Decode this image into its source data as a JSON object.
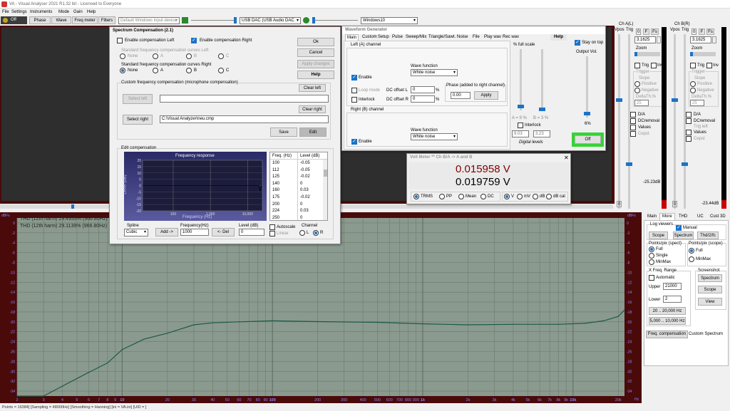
{
  "title": "VA - Visual Analyser 2021 R1.32 bit - Licensed to Everyone",
  "menu": [
    "File",
    "Settings",
    "Instruments",
    "Mode",
    "Gain",
    "Help"
  ],
  "toolbar": {
    "off": "Off",
    "phase": "Phase",
    "wave": "Wave",
    "freqmeter": "Freq meter",
    "filters": "Filters",
    "input_device": "Default Windows input device",
    "output_device": "USB DAC (USB Audio DAC",
    "os": "Windows10"
  },
  "spec_comp": {
    "title": "Spectrum Compensation (2.1)",
    "enable_left": "Enable compensation Left",
    "enable_right": "Enable compensation Right",
    "std_left": "Standard frequency compensation curves Left",
    "std_right": "Standard frequency compensation curves Right",
    "opts": [
      "None",
      "A",
      "B",
      "C"
    ],
    "ok": "Ok",
    "cancel": "Cancel",
    "apply": "Apply changes",
    "help": "Help",
    "custom_label": "Custom frequency compensation (microphone compensation)",
    "clear_left": "Clear left",
    "clear_right": "Clear right",
    "select_left": "Select left",
    "select_right": "Select right",
    "right_path": "C:\\Visual Analyzer\\neu.cmp",
    "save": "Save",
    "edit": "Edit",
    "edit_comp": "Edit compensation",
    "plot_title": "Frequency response",
    "plot_xlabel": "Frequency (Hz)",
    "plot_ylabel": "Level (dB)",
    "plot_yticks": [
      "20",
      "15",
      "10",
      "5",
      "0",
      "-5",
      "-10",
      "-15",
      "-20"
    ],
    "plot_xticks": [
      "100",
      "1,000",
      "10,000"
    ],
    "table_freq": "Freq. (Hz)",
    "table_level": "Level (dB)",
    "rows": [
      [
        "100",
        "-0.05"
      ],
      [
        "112",
        "-0.05"
      ],
      [
        "125",
        "-0.02"
      ],
      [
        "140",
        "0"
      ],
      [
        "160",
        "0.03"
      ],
      [
        "175",
        "-0.02"
      ],
      [
        "200",
        "0"
      ],
      [
        "224",
        "0.03"
      ],
      [
        "250",
        "0"
      ]
    ],
    "spline": "Spline",
    "spline_val": "Cubic",
    "add": "Add ->",
    "freq_lbl": "Frequency(Hz)",
    "freq_val": "1000",
    "del": "<- Del",
    "level_lbl": "Level (dB)",
    "level_val": "0",
    "autoscale": "Autoscale",
    "linear": "Linear",
    "channel": "Channel",
    "ch_l": "L",
    "ch_r": "R"
  },
  "wavegen": {
    "title": "Waveform Generator",
    "tabs": [
      "Main",
      "Custom",
      "Setup",
      "Pulse",
      "Sweep/Mix",
      "Triangle/Sawt.",
      "Noise",
      "File",
      "Play wav",
      "Rec wav",
      "Help"
    ],
    "left_ch": "Left (A) channel",
    "right_ch": "Right (B) channel",
    "wave_fn": "Wave function",
    "white_noise": "White noise",
    "enable": "Enable",
    "loop": "Loop mode",
    "interlock": "Interlock",
    "dcl": "DC offset L",
    "dcr": "DC offset R",
    "pct": "%",
    "zero": "0",
    "phase_lbl": "Phase (added to right channel)",
    "phase_val": "0.00",
    "apply": "Apply",
    "fullscale": "% full scale",
    "a_pct": "A = 9 %",
    "b_pct": "B = 3 %",
    "interlock2": "Interlock",
    "lvl_a": "9.03",
    "lvl_b": "3.23",
    "digital": "Digital levels",
    "stay_on_top": "Stay on top",
    "output_vol": "Output Vol.",
    "vol_pct": "6%",
    "off": "Off"
  },
  "voltmeter": {
    "title": "Volt Meter ** Ch B/A -> A and B",
    "v1": "0.015958 V",
    "v2": "0.019759 V",
    "modes": [
      "TRMS",
      "PP",
      "Mean",
      "DC"
    ],
    "units": [
      "V",
      "mV",
      "dB",
      "dB cal"
    ]
  },
  "ch_a": {
    "title": "Ch A(L)",
    "vpos": "Vpos",
    "trig": "Trig",
    "zero": "0",
    "f": "F",
    "fs": "Fs",
    "val": "3.1625",
    "zoom": "Zoom",
    "trig2": "Trig",
    "inv": "Inv",
    "trigger": "Trigger",
    "slope": "Slope",
    "pos": "Positive",
    "neg": "Negative",
    "delta": "DeltaTh.%",
    "delta_val": "25",
    "da": "D/A",
    "dcr": "DCremoval",
    "val_lbl": "Values",
    "cept": "Cepst",
    "db": "-25.23dB"
  },
  "ch_b": {
    "title": "Ch B(R)",
    "db": "-23.44dB",
    "trig_left": "Trig left"
  },
  "side": {
    "tabs": [
      "Main",
      "More",
      "THD",
      "UC",
      "Cust 3D"
    ],
    "log_viewers": "Log viewers",
    "manual": "Manual",
    "scope": "Scope",
    "spectrum": "Spectrum",
    "thd": "Thd/2/fc",
    "ppx_spect": "Points/pix (spect)",
    "ppx_scope": "Points/pix (scope)",
    "full": "Full",
    "single": "Single",
    "minmax": "MinMax",
    "freq_range": "X Freq. Range",
    "automatic": "Automatic",
    "upper": "Upper",
    "upper_val": "21000",
    "lower": "Lower",
    "lower_val": "2",
    "r1": "20 .. 20,000 Hz",
    "r2": "5,000 .. 10,000 Hz",
    "screenshot": "Screenshot",
    "view": "View",
    "freq_comp": "Freq. compensation",
    "custom_spec": "Custom Spectrum"
  },
  "spectrum": {
    "thd1": "THD (12th harm) 29.4933% (966.80Hz)",
    "thd2": "THD (12th harm) 29.1139% (966.80Hz)",
    "dbfs": "dBFs",
    "hz": "Hz",
    "yticks": [
      "0",
      "-2",
      "-4",
      "-6",
      "-8",
      "-10",
      "-12",
      "-14",
      "-16",
      "-18",
      "-20",
      "-22",
      "-24",
      "-26",
      "-28",
      "-30",
      "-32",
      "-34"
    ],
    "xticks": [
      "2",
      "3",
      "4",
      "5",
      "6",
      "7",
      "8",
      "9",
      "10",
      "20",
      "30",
      "40",
      "50",
      "60",
      "70",
      "80",
      "90",
      "100",
      "200",
      "300",
      "400",
      "500",
      "600",
      "700",
      "800",
      "900",
      "1k",
      "2k",
      "3k",
      "4k",
      "5k",
      "6k",
      "7k",
      "8k",
      "9k",
      "10k",
      "20k"
    ]
  },
  "chart_data": {
    "type": "line",
    "xscale": "log",
    "xlim": [
      2,
      22000
    ],
    "ylim": [
      -35,
      1
    ],
    "x": [
      2,
      3,
      4,
      6,
      8,
      10,
      14,
      20,
      30,
      40,
      60,
      100,
      200,
      500,
      1000,
      2000,
      4000,
      8000,
      12000,
      16000,
      20000,
      22000
    ],
    "y": [
      -35,
      -35,
      -33,
      -30.2,
      -28.3,
      -25.6,
      -23.5,
      -22.3,
      -20.6,
      -20.2,
      -20.0,
      -19.8,
      -19.95,
      -20.1,
      -20.4,
      -20.6,
      -20.5,
      -20.5,
      -20.3,
      -19.8,
      -18.9,
      -17.6
    ]
  },
  "status": "Points = 16384] [Sampling = 48000Hz] [Smoothing = Hanning] [ini = VA.ini] [UID = ]"
}
